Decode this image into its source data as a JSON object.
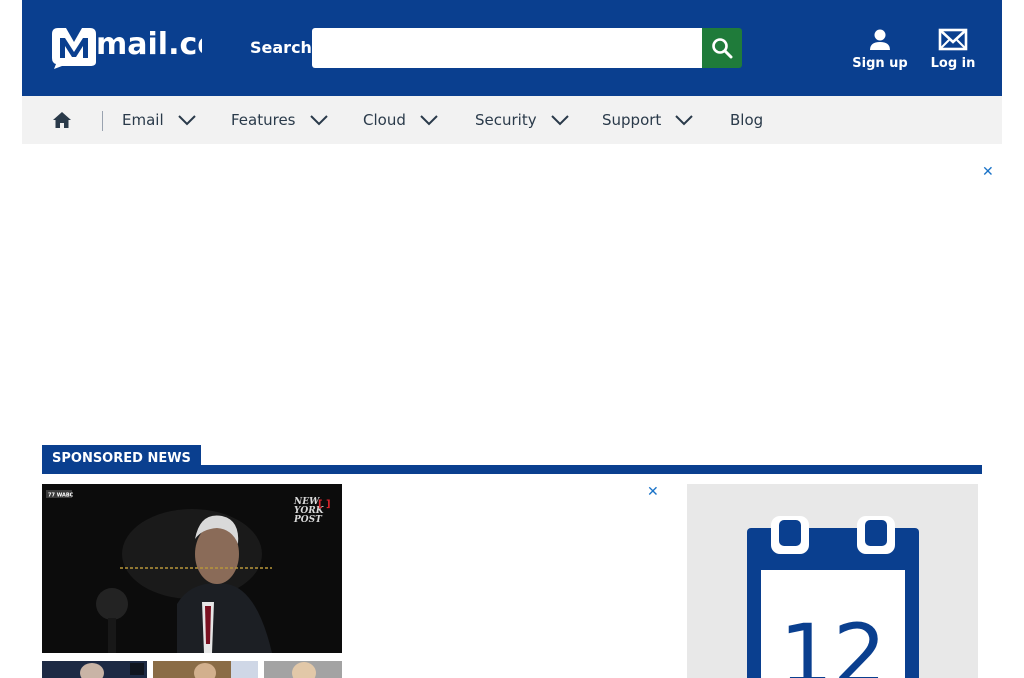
{
  "header": {
    "logo_text": "mail.com",
    "search_label": "Search",
    "search_placeholder": "",
    "signup_label": "Sign up",
    "login_label": "Log in"
  },
  "nav": {
    "items": [
      {
        "label": "Email"
      },
      {
        "label": "Features"
      },
      {
        "label": "Cloud"
      },
      {
        "label": "Security"
      },
      {
        "label": "Support"
      },
      {
        "label": "Blog"
      }
    ]
  },
  "ads": {
    "close_top": "✕",
    "close_mid": "✕"
  },
  "sponsored": {
    "heading": "SPONSORED NEWS",
    "main_badge": "77 WABC",
    "main_brand": "NEW YORK POST"
  },
  "calendar": {
    "day": "12"
  },
  "colors": {
    "brand": "#0a3f8f",
    "search_button": "#1f7b3a",
    "nav_bg": "#f2f2f2",
    "close_x": "#1a73c8"
  }
}
